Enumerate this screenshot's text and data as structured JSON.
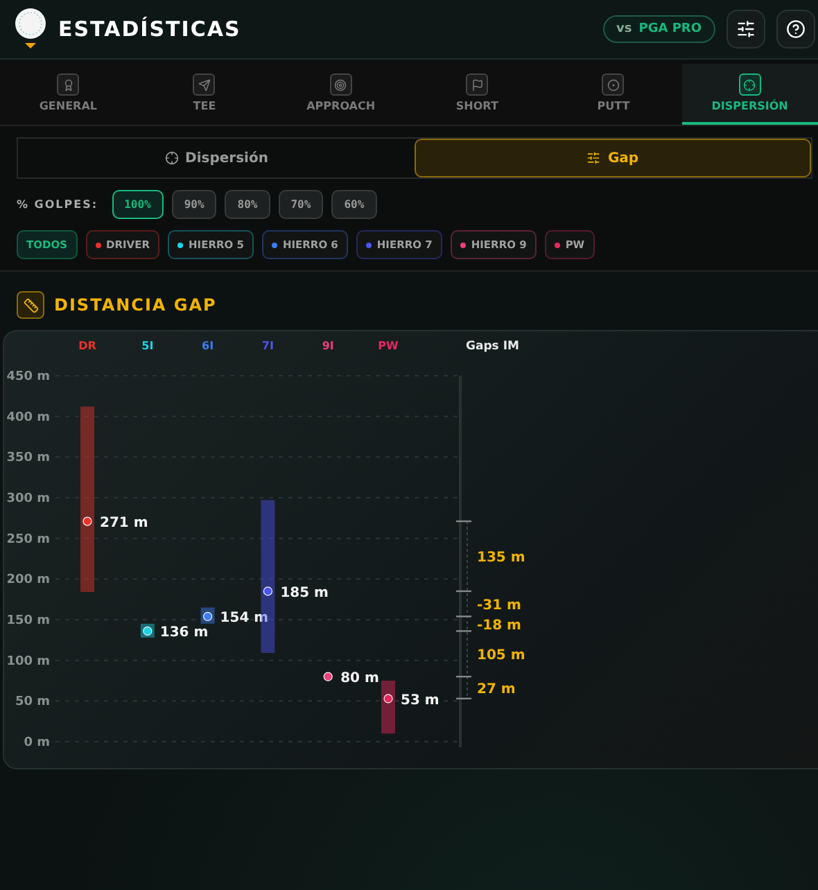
{
  "header": {
    "title": "ESTADÍSTICAS",
    "compare": {
      "prefix": "vs",
      "label": "PGA PRO"
    }
  },
  "tabs": [
    {
      "label": "GENERAL",
      "selected": false
    },
    {
      "label": "TEE",
      "selected": false
    },
    {
      "label": "APPROACH",
      "selected": false
    },
    {
      "label": "SHORT",
      "selected": false
    },
    {
      "label": "PUTT",
      "selected": false
    },
    {
      "label": "DISPERSIÓN",
      "selected": true
    }
  ],
  "view_toggle": [
    {
      "label": "Dispersión",
      "selected": false
    },
    {
      "label": "Gap",
      "selected": true
    }
  ],
  "percent_filter": {
    "label": "% GOLPES:",
    "options": [
      {
        "label": "100%",
        "selected": true
      },
      {
        "label": "90%",
        "selected": false
      },
      {
        "label": "80%",
        "selected": false
      },
      {
        "label": "70%",
        "selected": false
      },
      {
        "label": "60%",
        "selected": false
      }
    ]
  },
  "club_filter": [
    {
      "label": "TODOS",
      "selected": true
    },
    {
      "label": "DRIVER",
      "color": "#e8322a",
      "selected": false
    },
    {
      "label": "HIERRO 5",
      "color": "#19d3e6",
      "selected": false
    },
    {
      "label": "HIERRO 6",
      "color": "#3b7cf2",
      "selected": false
    },
    {
      "label": "HIERRO 7",
      "color": "#4a55f0",
      "selected": false
    },
    {
      "label": "HIERRO 9",
      "color": "#ec3f7c",
      "selected": false
    },
    {
      "label": "PW",
      "color": "#e8285e",
      "selected": false
    }
  ],
  "section": {
    "title": "DISTANCIA GAP",
    "chart_data": {
      "type": "scatter",
      "categories": [
        "DR",
        "5I",
        "6I",
        "7I",
        "9I",
        "PW"
      ],
      "yticks": [
        {
          "value": 0,
          "label": "0 m"
        },
        {
          "value": 50,
          "label": "50 m"
        },
        {
          "value": 100,
          "label": "100 m"
        },
        {
          "value": 150,
          "label": "150 m"
        },
        {
          "value": 200,
          "label": "200 m"
        },
        {
          "value": 250,
          "label": "250 m"
        },
        {
          "value": 300,
          "label": "300 m"
        },
        {
          "value": 350,
          "label": "350 m"
        },
        {
          "value": 400,
          "label": "400 m"
        },
        {
          "value": 450,
          "label": "450 m"
        }
      ],
      "ylim": [
        0,
        450
      ],
      "grid": true,
      "series": [
        {
          "colors": [
            "#e8322a",
            "#19d3e6",
            "#3b7cf2",
            "#4a55f0",
            "#ec3f7c",
            "#e8285e"
          ],
          "values": [
            271,
            136,
            154,
            185,
            80,
            53
          ],
          "errors": [
            [
              184,
              412
            ],
            [
              128,
              145
            ],
            [
              145,
              165
            ],
            [
              109,
              297
            ],
            null,
            [
              10,
              75
            ]
          ]
        }
      ],
      "value_labels": [
        "271 m",
        "136 m",
        "154 m",
        "185 m",
        "80 m",
        "53 m"
      ]
    },
    "gaps": {
      "title": "Gaps IM",
      "labels": [
        "135 m",
        "-31 m",
        "-18 m",
        "105 m",
        "27 m"
      ]
    }
  }
}
